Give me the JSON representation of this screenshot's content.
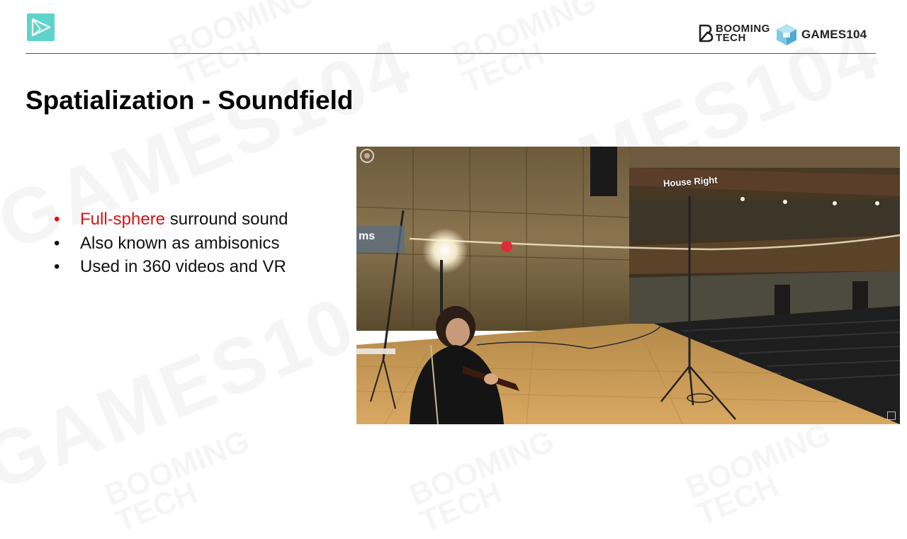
{
  "header": {
    "booming_text_line1": "BOOMING",
    "booming_text_line2": "TECH",
    "games_text": "GAMES104"
  },
  "slide": {
    "title": "Spatialization - Soundfield",
    "bullets": [
      {
        "highlight": "Full-sphere",
        "rest": " surround sound"
      },
      {
        "highlight": "",
        "rest": "Also known as ambisonics"
      },
      {
        "highlight": "",
        "rest": "Used in 360 videos and VR"
      }
    ]
  },
  "video": {
    "overlay_label": "House Right",
    "side_label": "ms"
  },
  "colors": {
    "accent_teal": "#5fd3cb",
    "highlight_red": "#e01010",
    "rule": "#555555"
  }
}
